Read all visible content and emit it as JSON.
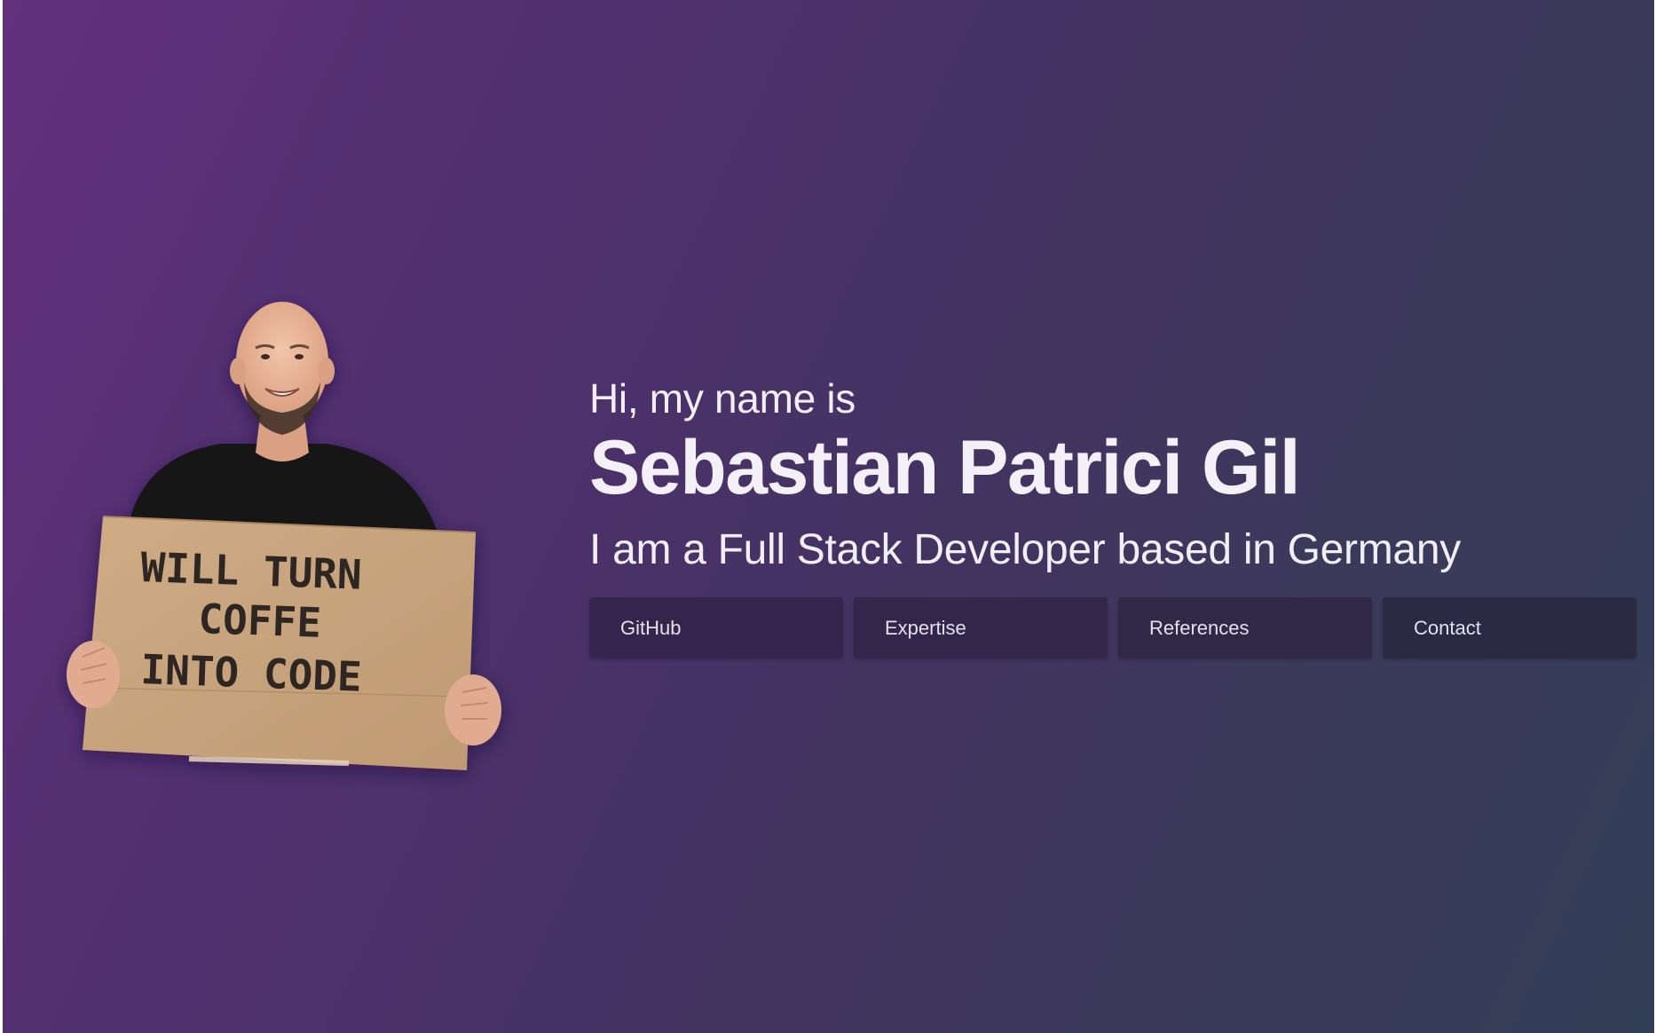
{
  "hero": {
    "greeting": "Hi, my name is",
    "name": "Sebastian Patrici Gil",
    "tagline": "I am a Full Stack Developer based in Germany"
  },
  "portrait": {
    "sign_lines": [
      "WILL TURN",
      "COFFE",
      "INTO CODE"
    ]
  },
  "nav": {
    "buttons": [
      {
        "label": "GitHub"
      },
      {
        "label": "Expertise"
      },
      {
        "label": "References"
      },
      {
        "label": "Contact"
      }
    ]
  },
  "colors": {
    "gradient_start": "#62307d",
    "gradient_end": "#333f57",
    "button_bg": "#32264a",
    "text": "#f1eef6"
  }
}
